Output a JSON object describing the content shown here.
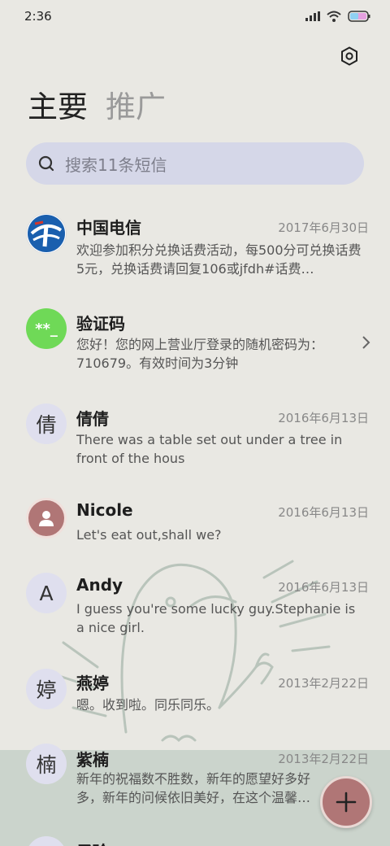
{
  "status_bar": {
    "time": "2:36"
  },
  "tabs": [
    {
      "label": "主要",
      "active": true
    },
    {
      "label": "推广",
      "active": false
    }
  ],
  "search": {
    "placeholder": "搜索11条短信"
  },
  "conversations": [
    {
      "name": "中国电信",
      "date": "2017年6月30日",
      "preview": "欢迎参加积分兑换话费活动，每500分可兑换话费5元，兑换话费请回复106或jfdh#话费…",
      "avatar": "china-telecom-logo"
    },
    {
      "name": "验证码",
      "date": "",
      "preview": "您好！您的网上营业厅登录的随机密码为：710679。有效时间为3分钟",
      "avatar_text": "**_"
    },
    {
      "name": "倩倩",
      "date": "2016年6月13日",
      "preview": "There was a table set out under a tree in front of the hous",
      "avatar_text": "倩"
    },
    {
      "name": "Nicole",
      "date": "2016年6月13日",
      "preview": "Let's eat out,shall we?",
      "avatar": "person-icon"
    },
    {
      "name": "Andy",
      "date": "2016年6月13日",
      "preview": "I guess you're some lucky guy.Stephanie is a nice girl.",
      "avatar_text": "A"
    },
    {
      "name": "燕婷",
      "date": "2013年2月22日",
      "preview": "嗯。收到啦。同乐同乐。",
      "avatar_text": "婷"
    },
    {
      "name": "紫楠",
      "date": "2013年2月22日",
      "preview": "新年的祝福数不胜数，新年的愿望好多好多，新年的问候依旧美好，在这个温馨的时刻",
      "avatar_text": "楠"
    },
    {
      "name": "子玲",
      "date": "",
      "preview": "",
      "avatar_text": "玲"
    }
  ],
  "colors": {
    "accent": "#b07676",
    "search_bg": "#d5d7e8",
    "verify_green": "#6fd957"
  }
}
